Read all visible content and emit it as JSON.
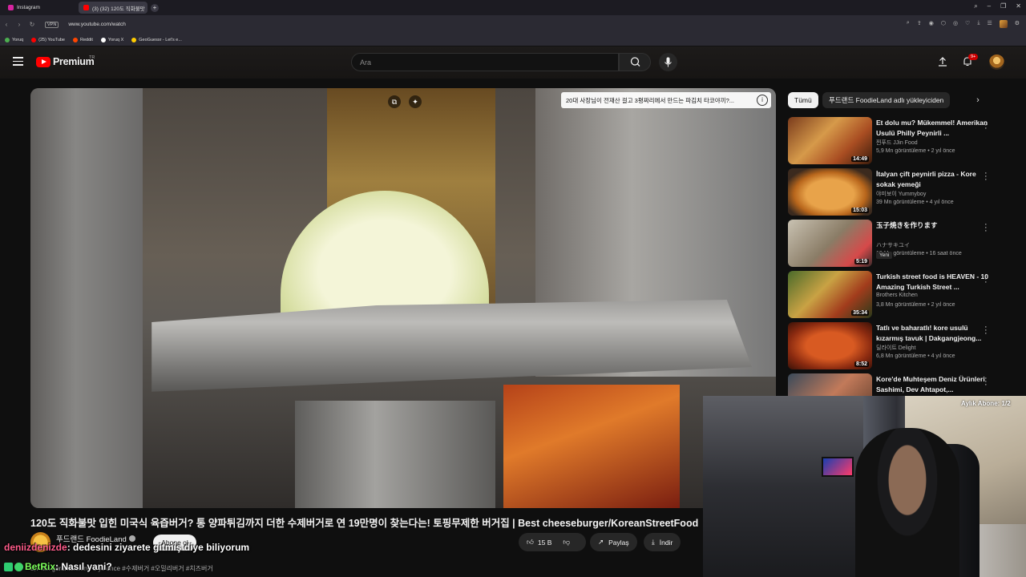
{
  "browser": {
    "tabs": [
      {
        "label": "Instagram",
        "active": false,
        "color": "#d6249f"
      },
      {
        "label": "(3) (32) 120도 직화불맛",
        "active": true,
        "color": "#ff0000"
      }
    ],
    "url": "www.youtube.com/watch",
    "vpn_label": "VPN",
    "bookmarks": [
      {
        "label": "Yoruq",
        "color": "#4caf50"
      },
      {
        "label": "(25) YouTube",
        "color": "#ff0000"
      },
      {
        "label": "Reddit",
        "color": "#ff4500"
      },
      {
        "label": "Yoruq X",
        "color": "#ffffff"
      },
      {
        "label": "GeoGuessr - Let's e...",
        "color": "#ffcc00"
      }
    ]
  },
  "header": {
    "logo_text": "Premium",
    "country": "TR",
    "search_placeholder": "Ara",
    "notification_count": "9+"
  },
  "video": {
    "banner_text": "20대 사장님이 전재산 걸고 3평짜리에서 만드는 파김치 타코야끼?...",
    "title": "120도 직화불맛 입힌 미국식 육즙버거? 통 양파튀김까지 더한 수제버거로 연 19만명이 찾는다는! 토핑무제한 버거집 | Best cheeseburger/KoreanStreetFood",
    "channel_name": "푸드랜드 FoodieLand",
    "subscribe_label": "Abone ol",
    "likes": "15 B",
    "share_label": "Paylaş",
    "download_label": "İndir",
    "description_snippet": "2,7 Mn görüntülenme 1 yıl önce #수제버거 #오밀리버거 #치즈버거"
  },
  "sidebar": {
    "chips": [
      {
        "label": "Tümü",
        "active": true
      },
      {
        "label": "푸드랜드 FoodieLand adlı yükleyiciden",
        "active": false
      }
    ],
    "recommendations": [
      {
        "title": "Et dolu mu? Mükemmel! Amerikan Usulü Philly Peynirli ...",
        "channel": "찐푸드 JJin Food",
        "meta": "5,9 Mn görüntüleme • 2 yıl önce",
        "duration": "14:49",
        "new": ""
      },
      {
        "title": "İtalyan çift peynirli pizza - Kore sokak yemeği",
        "channel": "야미보이 Yummyboy",
        "meta": "39 Mn görüntüleme • 4 yıl önce",
        "duration": "15:03",
        "new": ""
      },
      {
        "title": "玉子焼きを作ります",
        "channel": "ハナサキユイ",
        "meta": "19 Mn görüntüleme • 16 saat önce",
        "duration": "5:19",
        "new": "Yeni"
      },
      {
        "title": "Turkish street food is HEAVEN - 10 Amazing Turkish Street ...",
        "channel": "Brothers Kitchen",
        "meta": "3,8 Mn görüntüleme • 2 yıl önce",
        "duration": "35:34",
        "new": ""
      },
      {
        "title": "Tatlı ve baharatlı! kore usulü kızarmış tavuk | Dakgangjeong...",
        "channel": "딜라이트 Delight",
        "meta": "6,8 Mn görüntüleme • 4 yıl önce",
        "duration": "8:52",
        "new": ""
      },
      {
        "title": "Kore'de Muhteşem Deniz Ürünleri Sashimi, Dev Ahtapot,...",
        "channel": "",
        "meta": "",
        "duration": "",
        "new": ""
      }
    ]
  },
  "stream": {
    "sub_counter": "Aylık Abone: 1/2",
    "chat": [
      {
        "user": "deniizdenizde",
        "message": ": dedesini ziyarete gitmiş diye biliyorum"
      },
      {
        "user": "BetRix",
        "message": ": Nasıl yani?"
      }
    ]
  },
  "colors": {
    "youtube_red": "#ff0000",
    "background": "#0f0f0f",
    "chat_user1": "#ff5c8a",
    "chat_user2": "#7cff5c"
  }
}
